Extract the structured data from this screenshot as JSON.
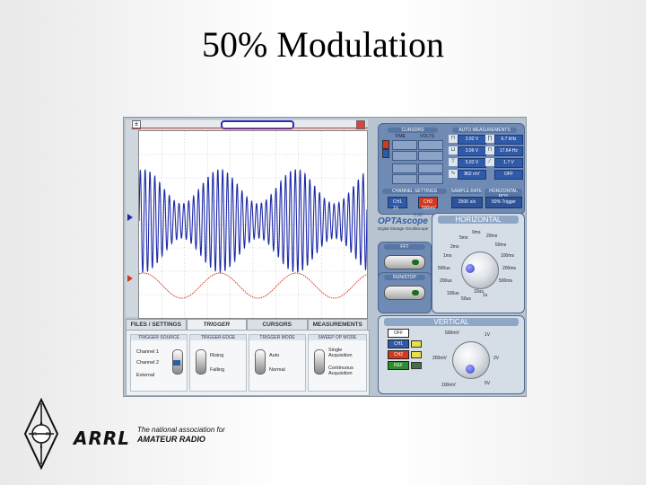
{
  "slide": {
    "title": "50% Modulation"
  },
  "logo": {
    "name": "ARRL",
    "tagline_line1": "The national association for",
    "tagline_line2": "AMATEUR RADIO"
  },
  "tabs": [
    "FILES / SETTINGS",
    "TRIGGER",
    "CURSORS",
    "MEASUREMENTS"
  ],
  "trigger_panel": {
    "source_header": "TRIGGER SOURCE",
    "source_options": [
      "Channel 1",
      "Channel 2",
      "External"
    ],
    "edge_header": "TRIGGER EDGE",
    "edge_options": [
      "Rising",
      "Falling"
    ],
    "mode_header": "TRIGGER MODE",
    "mode_options": [
      "Auto",
      "Normal"
    ],
    "sweep_header": "SWEEP OP MODE",
    "sweep_options": [
      "Single Acquisition",
      "Continuous Acquisition"
    ]
  },
  "cursors": {
    "header": "CURSORS",
    "col_time": "TIME",
    "col_volts": "VOLTS"
  },
  "auto_measurements": {
    "header": "AUTO MEASUREMENTS",
    "values": [
      "3.92 V",
      "6.7 kHz",
      "3.96 V",
      "17.64 Hz",
      "5.92 V",
      "1.7 V",
      "862 mV",
      "OFF"
    ]
  },
  "channel_settings": {
    "header": "CHANNEL SETTINGS",
    "ch1": "CH1",
    "ch2": "CH2",
    "ch1_scale": "1V",
    "ch2_scale": "500mV"
  },
  "sample_rate": {
    "header": "SAMPLE RATE",
    "value": "250K s/s"
  },
  "horizontal_pos": {
    "header": "HORIZONTAL POS",
    "value": "50% Trigger"
  },
  "brand": {
    "name": "OPTAscope",
    "version": "2.90",
    "subtitle": "Digital Storage Oscilloscope"
  },
  "horizontal": {
    "header": "HORIZONTAL",
    "labels": [
      "0ms",
      "5ms",
      "20ms",
      "2ms",
      "50ms",
      "1ms",
      "100ms",
      "500us",
      "200ms",
      "200us",
      "500ms",
      "100us",
      "50us",
      "1s",
      "10us"
    ]
  },
  "fft": {
    "label": "FFT"
  },
  "runstop": {
    "label": "RUN/STOP"
  },
  "vertical": {
    "header": "VERTICAL",
    "buttons": [
      "OFF",
      "CH1",
      "CH2",
      "REF"
    ],
    "labels": [
      "500mV",
      "1V",
      "200mV",
      "2V",
      "5V",
      "100mV"
    ]
  },
  "colors": {
    "ch1": "#1d2aa8",
    "ch2": "#d13a22",
    "panel": "#6f8ab3",
    "accent": "#2f5aa8"
  },
  "chart_data": {
    "type": "line",
    "series": [
      {
        "name": "CH1",
        "description_values": "amplitude-modulated carrier, 50% modulation"
      },
      {
        "name": "CH2",
        "description_values": "modulating sine"
      }
    ]
  }
}
